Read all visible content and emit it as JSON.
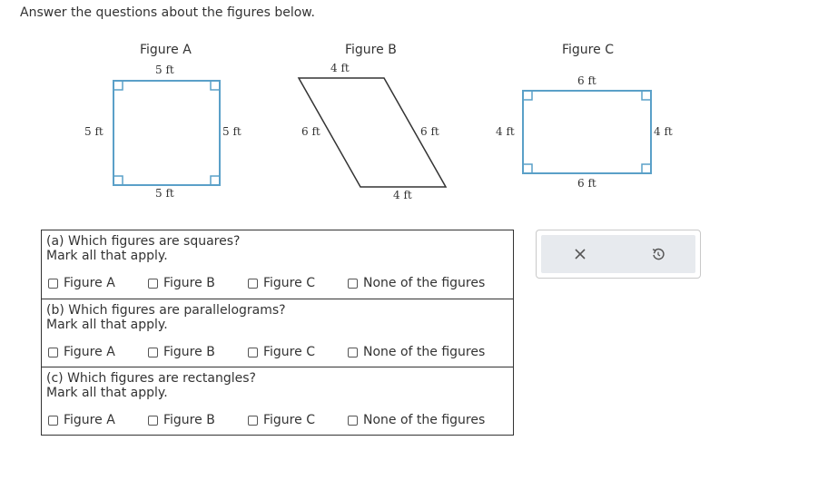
{
  "instruction": "Answer the questions about the figures below.",
  "figures": {
    "a": {
      "title": "Figure A",
      "top": "5 ft",
      "left": "5 ft",
      "right": "5 ft",
      "bottom": "5 ft"
    },
    "b": {
      "title": "Figure B",
      "top": "4 ft",
      "left": "6 ft",
      "right": "6 ft",
      "bottom": "4 ft"
    },
    "c": {
      "title": "Figure C",
      "top": "6 ft",
      "left": "4 ft",
      "right": "4 ft",
      "bottom": "6 ft"
    }
  },
  "questions": [
    {
      "prompt": "(a) Which figures are squares?",
      "instruction": "Mark all that apply.",
      "options": [
        "Figure A",
        "Figure B",
        "Figure C",
        "None of the figures"
      ]
    },
    {
      "prompt": "(b) Which figures are parallelograms?",
      "instruction": "Mark all that apply.",
      "options": [
        "Figure A",
        "Figure B",
        "Figure C",
        "None of the figures"
      ]
    },
    {
      "prompt": "(c) Which figures are rectangles?",
      "instruction": "Mark all that apply.",
      "options": [
        "Figure A",
        "Figure B",
        "Figure C",
        "None of the figures"
      ]
    }
  ],
  "toolbox": {
    "clear_icon": "x-icon",
    "reset_icon": "undo-icon"
  },
  "colors": {
    "figure_stroke": "#5aa0c8",
    "parallelogram_stroke": "#333333",
    "toolbar_bg": "#e7eaee"
  }
}
